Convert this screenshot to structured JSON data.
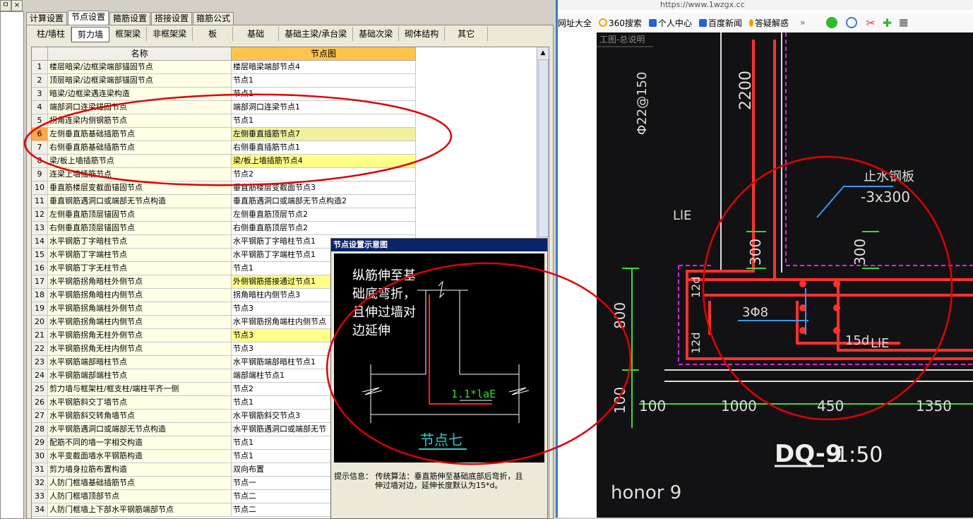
{
  "left_strip": {
    "ctrl1": "ㅁ",
    "ctrl2": "×"
  },
  "main_tabs": [
    "计算设置",
    "节点设置",
    "箍筋设置",
    "搭接设置",
    "箍筋公式"
  ],
  "sub_tabs": [
    "柱/墙柱",
    "剪力墙",
    "框架梁",
    "非框架梁",
    "板",
    "基础",
    "基础主梁/承台梁",
    "基础次梁",
    "砌体结构",
    "其它"
  ],
  "grid": {
    "col_name": "名称",
    "col_node": "节点图",
    "rows": [
      {
        "num": "1",
        "name": "楼层暗梁/边框梁端部锚固节点",
        "node": "楼层暗梁端部节点4"
      },
      {
        "num": "2",
        "name": "顶层暗梁/边框梁端部锚固节点",
        "node": "节点1"
      },
      {
        "num": "3",
        "name": "暗梁/边框梁遇连梁构造",
        "node": "节点1"
      },
      {
        "num": "4",
        "name": "端部洞口连梁锚固节点",
        "node": "端部洞口连梁节点1"
      },
      {
        "num": "5",
        "name": "拐角连梁内侧钢筋节点",
        "node": "节点1"
      },
      {
        "num": "6",
        "name": "左侧垂直筋基础插筋节点",
        "node": "左侧垂直插筋节点7"
      },
      {
        "num": "7",
        "name": "右侧垂直筋基础插筋节点",
        "node": "右侧垂直插筋节点1"
      },
      {
        "num": "8",
        "name": "梁/板上墙插筋节点",
        "node": "梁/板上墙插筋节点4"
      },
      {
        "num": "9",
        "name": "连梁上墙插筋节点",
        "node": "节点2"
      },
      {
        "num": "10",
        "name": "垂直筋楼层变截面锚固节点",
        "node": "垂直筋楼层变截面节点3"
      },
      {
        "num": "11",
        "name": "垂直钢筋遇洞口或端部无节点构造",
        "node": "垂直筋遇洞口或端部无节点构造2"
      },
      {
        "num": "12",
        "name": "左侧垂直筋顶层锚固节点",
        "node": "左侧垂直筋顶层节点2"
      },
      {
        "num": "13",
        "name": "右侧垂直筋顶层锚固节点",
        "node": "右侧垂直筋顶层节点2"
      },
      {
        "num": "14",
        "name": "水平钢筋丁字暗柱节点",
        "node": "水平钢筋丁字暗柱节点1"
      },
      {
        "num": "15",
        "name": "水平钢筋丁字端柱节点",
        "node": "水平钢筋丁字端柱节点1"
      },
      {
        "num": "16",
        "name": "水平钢筋丁字无柱节点",
        "node": "节点1"
      },
      {
        "num": "17",
        "name": "水平钢筋拐角暗柱外侧节点",
        "node": "外侧钢筋搭接通过节点1"
      },
      {
        "num": "18",
        "name": "水平钢筋拐角暗柱内侧节点",
        "node": "拐角暗柱内侧节点3"
      },
      {
        "num": "19",
        "name": "水平钢筋拐角端柱外侧节点",
        "node": "节点3"
      },
      {
        "num": "20",
        "name": "水平钢筋拐角端柱内侧节点",
        "node": "水平钢筋拐角端柱内侧节点"
      },
      {
        "num": "21",
        "name": "水平钢筋拐角无柱外侧节点",
        "node": "节点3"
      },
      {
        "num": "22",
        "name": "水平钢筋拐角无柱内侧节点",
        "node": "节点3"
      },
      {
        "num": "23",
        "name": "水平钢筋端部暗柱节点",
        "node": "水平钢筋端部暗柱节点1"
      },
      {
        "num": "24",
        "name": "水平钢筋端部端柱节点",
        "node": "端部端柱节点1"
      },
      {
        "num": "25",
        "name": "剪力墙与框架柱/框支柱/端柱平齐一侧",
        "node": "节点2"
      },
      {
        "num": "26",
        "name": "水平钢筋斜交丁墙节点",
        "node": "节点1"
      },
      {
        "num": "27",
        "name": "水平钢筋斜交转角墙节点",
        "node": "水平钢筋斜交节点3"
      },
      {
        "num": "28",
        "name": "水平钢筋遇洞口或端部无节点构造",
        "node": "水平钢筋遇洞口或端部无节"
      },
      {
        "num": "29",
        "name": "配筋不同的墙一字相交构造",
        "node": "节点1"
      },
      {
        "num": "30",
        "name": "水平变截面墙水平钢筋构造",
        "node": "节点1"
      },
      {
        "num": "31",
        "name": "剪力墙身拉筋布置构造",
        "node": "双向布置"
      },
      {
        "num": "32",
        "name": "人防门框墙基础插筋节点",
        "node": "节点一"
      },
      {
        "num": "33",
        "name": "人防门框墙顶部节点",
        "node": "节点二"
      },
      {
        "num": "34",
        "name": "人防门框墙上下部水平钢筋端部节点",
        "node": "节点二"
      }
    ]
  },
  "popup": {
    "title": "节点设置示意图",
    "desc_lines": [
      "纵筋伸至基",
      "础底弯折，",
      "且伸过墙对",
      "边延伸"
    ],
    "dim_label": "1.1*laE",
    "node_label": "节点七",
    "info_label": "提示信息：",
    "info_text_1": "传统算法：垂直筋伸至基础底部后弯折，且",
    "info_text_2": "伸过墙对边，延伸长度默认为15*d。"
  },
  "browser": {
    "address": "https://www.1wzgx.cc",
    "bookmarks": [
      "网址大全",
      "360搜索",
      "个人中心",
      "百度新闻",
      "答疑解惑"
    ],
    "more": "»"
  },
  "photo": {
    "header_text": "工图-总说明",
    "texts": {
      "rebar_spec": "Φ22@150",
      "dim_2200": "2200",
      "lle_1": "LlE",
      "waterstop": "止水钢板",
      "waterstop_size": "-3x300",
      "dim_300_left": "300",
      "dim_300_right": "300",
      "dim_12d_top": "12d",
      "dim_12d_bot": "12d",
      "bars": "3Φ8",
      "dim_15d": "15d",
      "lle_2": "LlE",
      "dim_800": "800",
      "dim_100_v": "100",
      "dim_100": "100",
      "dim_1000": "1000",
      "dim_450": "450",
      "dim_1350": "1350",
      "drawing_id": "DQ-9",
      "scale": "1:50",
      "watermark": "honor 9"
    }
  },
  "colors": {
    "annotation_red": "#e00000",
    "header_orange": "#ffc24a",
    "rebar_red": "#ff3030"
  }
}
